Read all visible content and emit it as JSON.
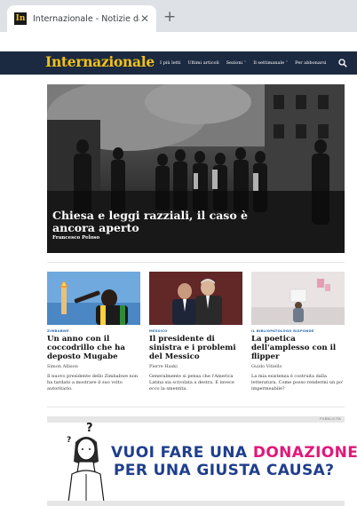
{
  "browser": {
    "tab_title": "Internazionale - Notizie dall'Italia",
    "favicon_text": "In",
    "close_glyph": "✕",
    "newtab_glyph": "+"
  },
  "site": {
    "logo": "Internazionale",
    "nav": [
      {
        "label": "I più letti"
      },
      {
        "label": "Ultimi articoli"
      },
      {
        "label": "Sezioni ˅"
      },
      {
        "label": "Il settimanale ˅"
      },
      {
        "label": "Per abbonarsi"
      }
    ],
    "search_icon": "search-icon",
    "colors": {
      "nav_bg": "#1b2a40",
      "logo": "#f2c01a",
      "kicker": "#2a6fb4"
    }
  },
  "hero": {
    "title": "Chiesa e leggi razziali, il caso è ancora aperto",
    "author": "Francesco Peloso"
  },
  "cards": [
    {
      "kicker": "Zimbabwe",
      "title": "Un anno con il coccodrillo che ha deposto Mugabe",
      "author": "Simon Allison",
      "excerpt": "Il nuovo presidente dello Zimbabwe non ha tardato a mostrare il suo volto autoritario."
    },
    {
      "kicker": "Messico",
      "title": "Il presidente di sinistra e i problemi del Messico",
      "author": "Pierre Haski",
      "excerpt": "Generalmente si pensa che l'America Latina sia scivolata a destra. E invece ecco la smentita."
    },
    {
      "kicker": "Il bibliopatologo risponde",
      "title": "La poetica dell'amplesso con il flipper",
      "author": "Guido Vitiello",
      "excerpt": "La mia esistenza è costruita dalla letteratura. Come posso rendermi un po' impermeabile?"
    }
  ],
  "ad": {
    "label": "PUBBLICITÀ",
    "line1_a": "VUOI FARE UNA ",
    "line1_b": "DONAZIONE",
    "line2": "PER UNA GIUSTA CAUSA?",
    "question_mark": "?",
    "colors": {
      "blue": "#1f3e8c",
      "magenta": "#e2187a"
    }
  }
}
